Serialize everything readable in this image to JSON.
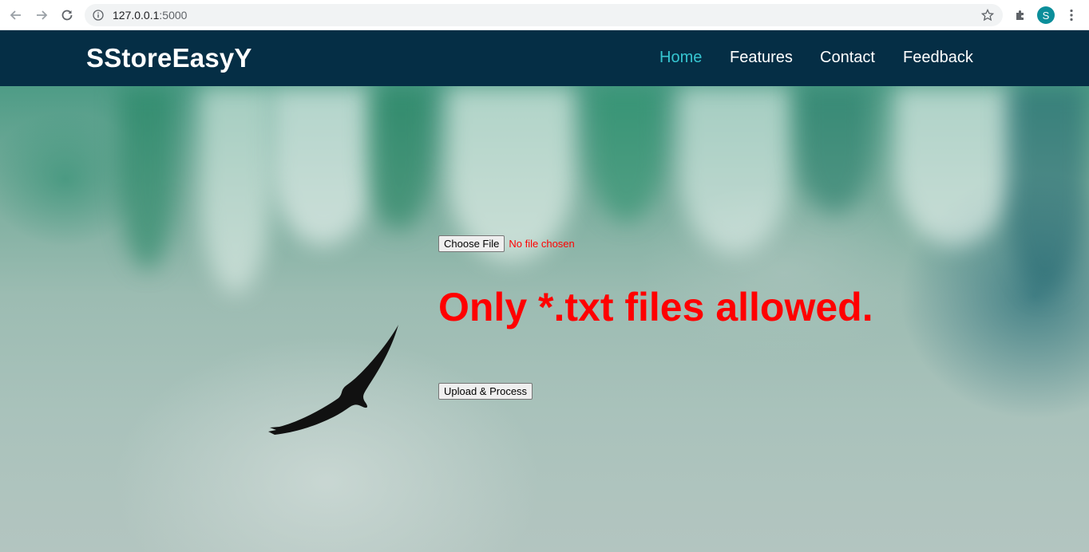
{
  "browser": {
    "url_host": "127.0.0.1",
    "url_port": ":5000",
    "avatar_letter": "S",
    "icons": [
      "back-icon",
      "forward-icon",
      "reload-icon",
      "info-icon",
      "star-icon",
      "extensions-icon",
      "more-icon"
    ]
  },
  "navbar": {
    "brand": "SStoreEasyY",
    "links": [
      {
        "label": "Home",
        "active": true
      },
      {
        "label": "Features",
        "active": false
      },
      {
        "label": "Contact",
        "active": false
      },
      {
        "label": "Feedback",
        "active": false
      }
    ],
    "background_color": "#052e45",
    "active_color": "#36c5d0"
  },
  "upload_form": {
    "choose_file_label": "Choose File",
    "file_status": "No file chosen",
    "warning": "Only *.txt files allowed.",
    "submit_label": "Upload & Process",
    "warning_color": "#ff0000"
  }
}
